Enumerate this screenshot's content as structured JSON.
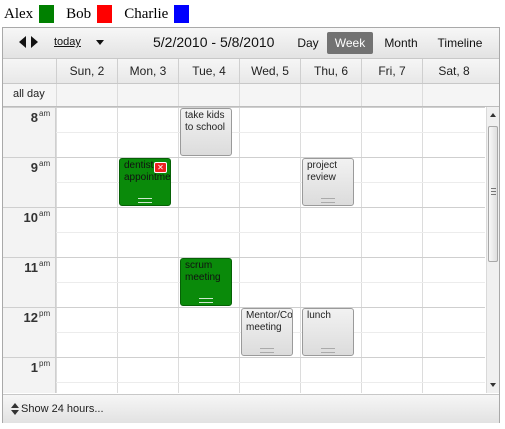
{
  "legend": [
    {
      "name": "Alex",
      "color": "#008000"
    },
    {
      "name": "Bob",
      "color": "#ff0000"
    },
    {
      "name": "Charlie",
      "color": "#0000ff"
    }
  ],
  "toolbar": {
    "today_label": "today",
    "date_range": "5/2/2010 - 5/8/2010",
    "views": {
      "day": "Day",
      "week": "Week",
      "month": "Month",
      "timeline": "Timeline"
    },
    "active_view": "Week"
  },
  "days": [
    "Sun, 2",
    "Mon, 3",
    "Tue, 4",
    "Wed, 5",
    "Thu, 6",
    "Fri, 7",
    "Sat, 8"
  ],
  "allday_label": "all day",
  "hours": [
    {
      "h": "8",
      "ap": "am"
    },
    {
      "h": "9",
      "ap": "am"
    },
    {
      "h": "10",
      "ap": "am"
    },
    {
      "h": "11",
      "ap": "am"
    },
    {
      "h": "12",
      "ap": "pm"
    },
    {
      "h": "1",
      "ap": "pm"
    }
  ],
  "events": {
    "take_kids": "take kids to school",
    "dentist": "dentist appointment",
    "project_review": "project review",
    "scrum": "scrum meeting",
    "mentor": "Mentor/Coaching meeting",
    "lunch": "lunch"
  },
  "colors": {
    "green_event": "#0a8a0a",
    "gray_event": "#e6e6e6",
    "active_view_bg": "#727272"
  },
  "footer": {
    "show_hours": "Show 24 hours..."
  }
}
